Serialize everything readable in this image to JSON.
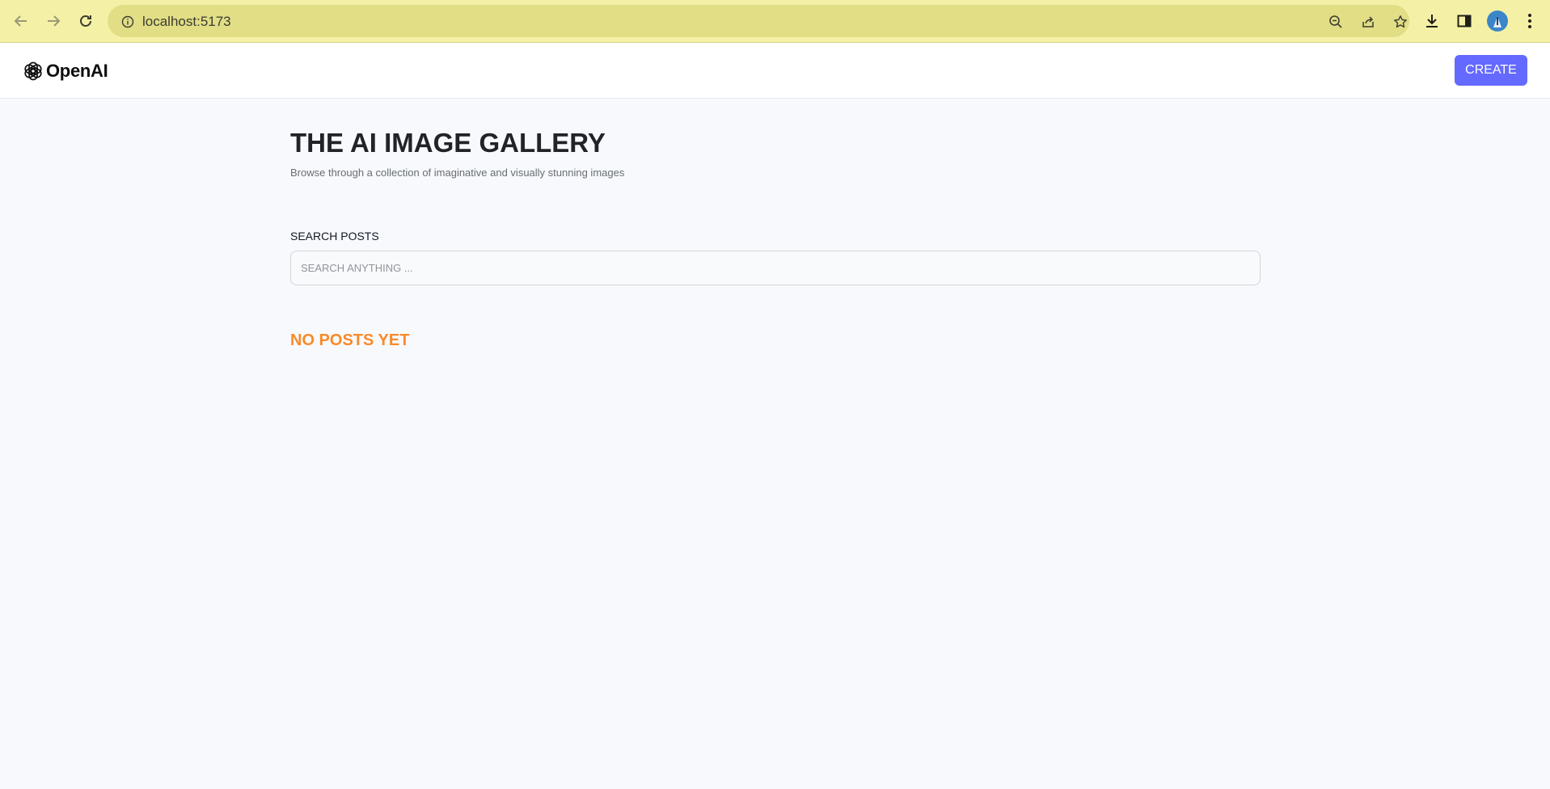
{
  "browser": {
    "url": "localhost:5173",
    "icons": {
      "back": "arrow-left-icon",
      "forward": "arrow-right-icon",
      "reload": "reload-icon",
      "site_info": "info-icon",
      "zoom": "zoom-out-icon",
      "share": "share-icon",
      "bookmark": "star-icon",
      "download": "download-icon",
      "side_panel": "side-panel-icon",
      "profile": "avatar",
      "menu": "kebab-menu-icon"
    },
    "colors": {
      "toolbar_bg": "#f4f1a6",
      "omnibox_bg": "#e1de86"
    }
  },
  "header": {
    "logo_text": "OpenAI",
    "create_label": "CREATE",
    "colors": {
      "accent": "#6469ff"
    }
  },
  "main": {
    "title": "THE AI IMAGE GALLERY",
    "subtitle": "Browse through a collection of imaginative and visually stunning images",
    "search": {
      "label": "SEARCH POSTS",
      "placeholder": "SEARCH ANYTHING ...",
      "value": ""
    },
    "empty_message": "NO POSTS YET",
    "colors": {
      "empty_message": "#f98a2a"
    }
  }
}
